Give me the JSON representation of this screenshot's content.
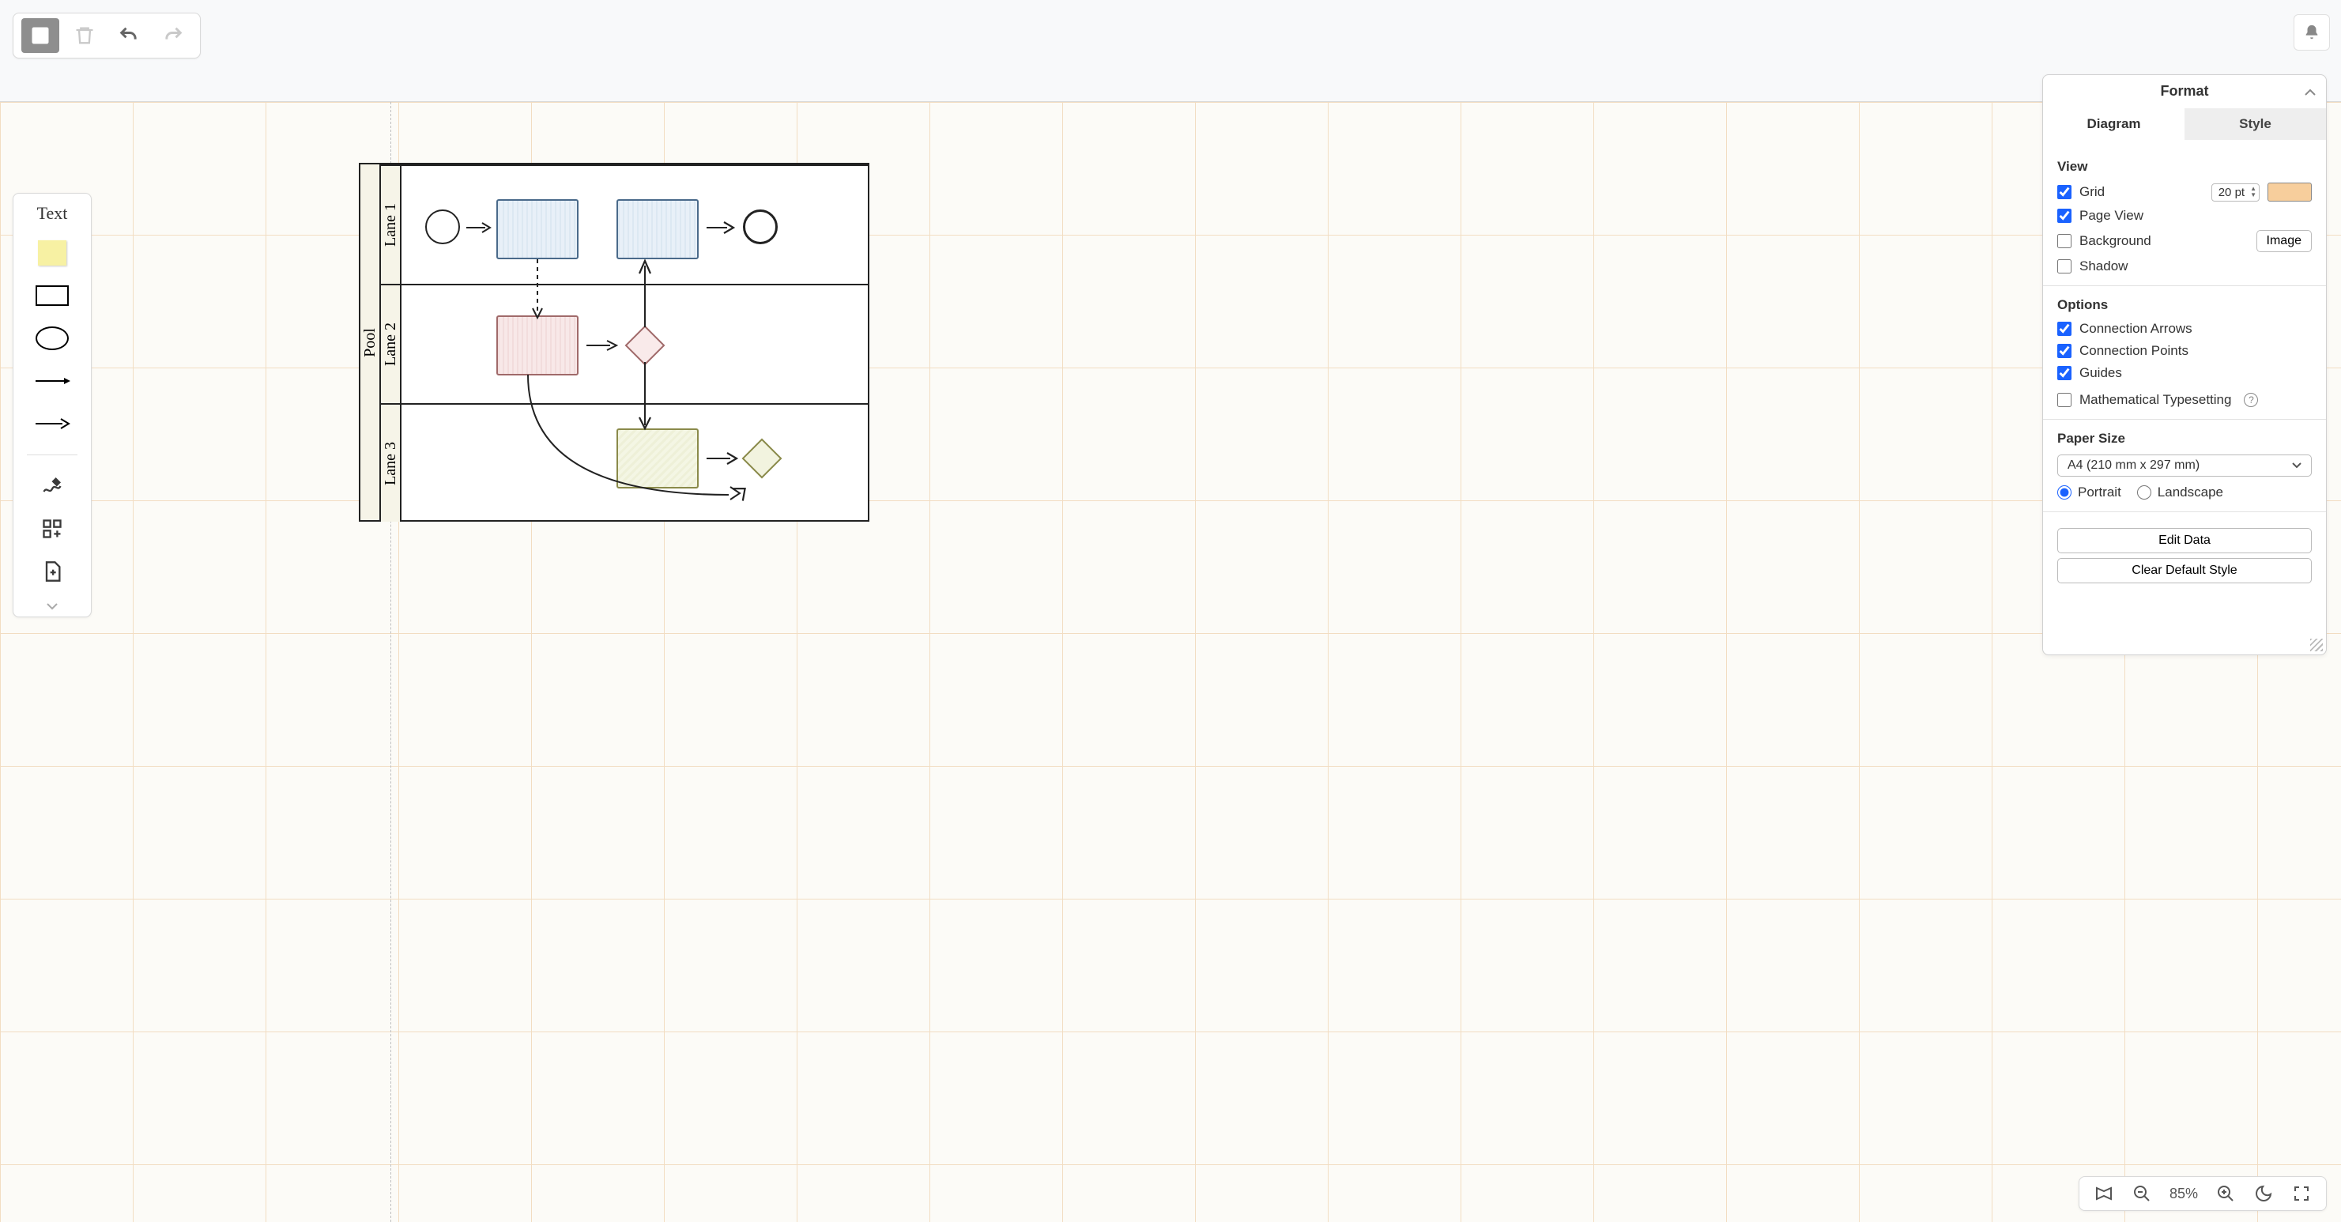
{
  "toolbar": {
    "sitemap_tooltip": "Shapes",
    "delete_tooltip": "Delete",
    "undo_tooltip": "Undo",
    "redo_tooltip": "Redo",
    "notifications_tooltip": "Notifications"
  },
  "palette": {
    "text_label": "Text"
  },
  "diagram_canvas": {
    "pool_label": "Pool",
    "lanes": [
      "Lane 1",
      "Lane 2",
      "Lane 3"
    ]
  },
  "format_panel": {
    "title": "Format",
    "tabs": {
      "diagram": "Diagram",
      "style": "Style",
      "active": "diagram"
    },
    "view": {
      "heading": "View",
      "grid_label": "Grid",
      "grid_checked": true,
      "grid_size": "20",
      "grid_unit": "pt",
      "grid_color": "#f7ce9c",
      "page_view_label": "Page View",
      "page_view_checked": true,
      "background_label": "Background",
      "background_checked": false,
      "image_button": "Image",
      "shadow_label": "Shadow",
      "shadow_checked": false
    },
    "options": {
      "heading": "Options",
      "connection_arrows_label": "Connection Arrows",
      "connection_arrows_checked": true,
      "connection_points_label": "Connection Points",
      "connection_points_checked": true,
      "guides_label": "Guides",
      "guides_checked": true,
      "math_label": "Mathematical Typesetting",
      "math_checked": false
    },
    "paper": {
      "heading": "Paper Size",
      "size_value": "A4 (210 mm x 297 mm)",
      "portrait_label": "Portrait",
      "landscape_label": "Landscape",
      "orientation": "portrait"
    },
    "edit_data_button": "Edit Data",
    "clear_style_button": "Clear Default Style"
  },
  "status": {
    "zoom_pct": "85%"
  }
}
